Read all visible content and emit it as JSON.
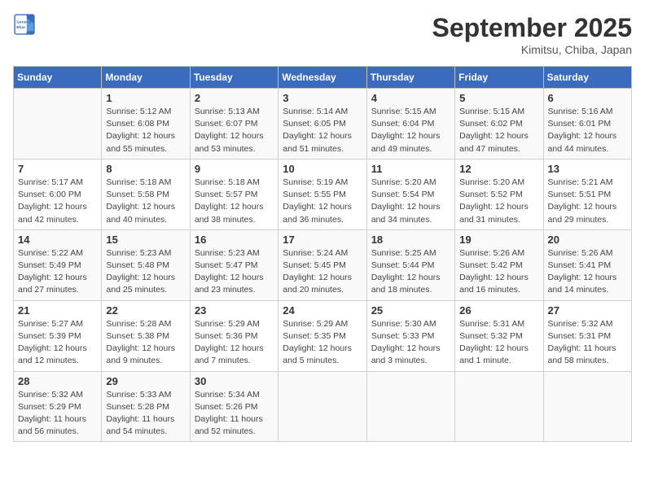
{
  "header": {
    "logo_line1": "General",
    "logo_line2": "Blue",
    "month": "September 2025",
    "location": "Kimitsu, Chiba, Japan"
  },
  "columns": [
    "Sunday",
    "Monday",
    "Tuesday",
    "Wednesday",
    "Thursday",
    "Friday",
    "Saturday"
  ],
  "weeks": [
    [
      {
        "num": "",
        "info": ""
      },
      {
        "num": "1",
        "info": "Sunrise: 5:12 AM\nSunset: 6:08 PM\nDaylight: 12 hours\nand 55 minutes."
      },
      {
        "num": "2",
        "info": "Sunrise: 5:13 AM\nSunset: 6:07 PM\nDaylight: 12 hours\nand 53 minutes."
      },
      {
        "num": "3",
        "info": "Sunrise: 5:14 AM\nSunset: 6:05 PM\nDaylight: 12 hours\nand 51 minutes."
      },
      {
        "num": "4",
        "info": "Sunrise: 5:15 AM\nSunset: 6:04 PM\nDaylight: 12 hours\nand 49 minutes."
      },
      {
        "num": "5",
        "info": "Sunrise: 5:15 AM\nSunset: 6:02 PM\nDaylight: 12 hours\nand 47 minutes."
      },
      {
        "num": "6",
        "info": "Sunrise: 5:16 AM\nSunset: 6:01 PM\nDaylight: 12 hours\nand 44 minutes."
      }
    ],
    [
      {
        "num": "7",
        "info": "Sunrise: 5:17 AM\nSunset: 6:00 PM\nDaylight: 12 hours\nand 42 minutes."
      },
      {
        "num": "8",
        "info": "Sunrise: 5:18 AM\nSunset: 5:58 PM\nDaylight: 12 hours\nand 40 minutes."
      },
      {
        "num": "9",
        "info": "Sunrise: 5:18 AM\nSunset: 5:57 PM\nDaylight: 12 hours\nand 38 minutes."
      },
      {
        "num": "10",
        "info": "Sunrise: 5:19 AM\nSunset: 5:55 PM\nDaylight: 12 hours\nand 36 minutes."
      },
      {
        "num": "11",
        "info": "Sunrise: 5:20 AM\nSunset: 5:54 PM\nDaylight: 12 hours\nand 34 minutes."
      },
      {
        "num": "12",
        "info": "Sunrise: 5:20 AM\nSunset: 5:52 PM\nDaylight: 12 hours\nand 31 minutes."
      },
      {
        "num": "13",
        "info": "Sunrise: 5:21 AM\nSunset: 5:51 PM\nDaylight: 12 hours\nand 29 minutes."
      }
    ],
    [
      {
        "num": "14",
        "info": "Sunrise: 5:22 AM\nSunset: 5:49 PM\nDaylight: 12 hours\nand 27 minutes."
      },
      {
        "num": "15",
        "info": "Sunrise: 5:23 AM\nSunset: 5:48 PM\nDaylight: 12 hours\nand 25 minutes."
      },
      {
        "num": "16",
        "info": "Sunrise: 5:23 AM\nSunset: 5:47 PM\nDaylight: 12 hours\nand 23 minutes."
      },
      {
        "num": "17",
        "info": "Sunrise: 5:24 AM\nSunset: 5:45 PM\nDaylight: 12 hours\nand 20 minutes."
      },
      {
        "num": "18",
        "info": "Sunrise: 5:25 AM\nSunset: 5:44 PM\nDaylight: 12 hours\nand 18 minutes."
      },
      {
        "num": "19",
        "info": "Sunrise: 5:26 AM\nSunset: 5:42 PM\nDaylight: 12 hours\nand 16 minutes."
      },
      {
        "num": "20",
        "info": "Sunrise: 5:26 AM\nSunset: 5:41 PM\nDaylight: 12 hours\nand 14 minutes."
      }
    ],
    [
      {
        "num": "21",
        "info": "Sunrise: 5:27 AM\nSunset: 5:39 PM\nDaylight: 12 hours\nand 12 minutes."
      },
      {
        "num": "22",
        "info": "Sunrise: 5:28 AM\nSunset: 5:38 PM\nDaylight: 12 hours\nand 9 minutes."
      },
      {
        "num": "23",
        "info": "Sunrise: 5:29 AM\nSunset: 5:36 PM\nDaylight: 12 hours\nand 7 minutes."
      },
      {
        "num": "24",
        "info": "Sunrise: 5:29 AM\nSunset: 5:35 PM\nDaylight: 12 hours\nand 5 minutes."
      },
      {
        "num": "25",
        "info": "Sunrise: 5:30 AM\nSunset: 5:33 PM\nDaylight: 12 hours\nand 3 minutes."
      },
      {
        "num": "26",
        "info": "Sunrise: 5:31 AM\nSunset: 5:32 PM\nDaylight: 12 hours\nand 1 minute."
      },
      {
        "num": "27",
        "info": "Sunrise: 5:32 AM\nSunset: 5:31 PM\nDaylight: 11 hours\nand 58 minutes."
      }
    ],
    [
      {
        "num": "28",
        "info": "Sunrise: 5:32 AM\nSunset: 5:29 PM\nDaylight: 11 hours\nand 56 minutes."
      },
      {
        "num": "29",
        "info": "Sunrise: 5:33 AM\nSunset: 5:28 PM\nDaylight: 11 hours\nand 54 minutes."
      },
      {
        "num": "30",
        "info": "Sunrise: 5:34 AM\nSunset: 5:26 PM\nDaylight: 11 hours\nand 52 minutes."
      },
      {
        "num": "",
        "info": ""
      },
      {
        "num": "",
        "info": ""
      },
      {
        "num": "",
        "info": ""
      },
      {
        "num": "",
        "info": ""
      }
    ]
  ]
}
